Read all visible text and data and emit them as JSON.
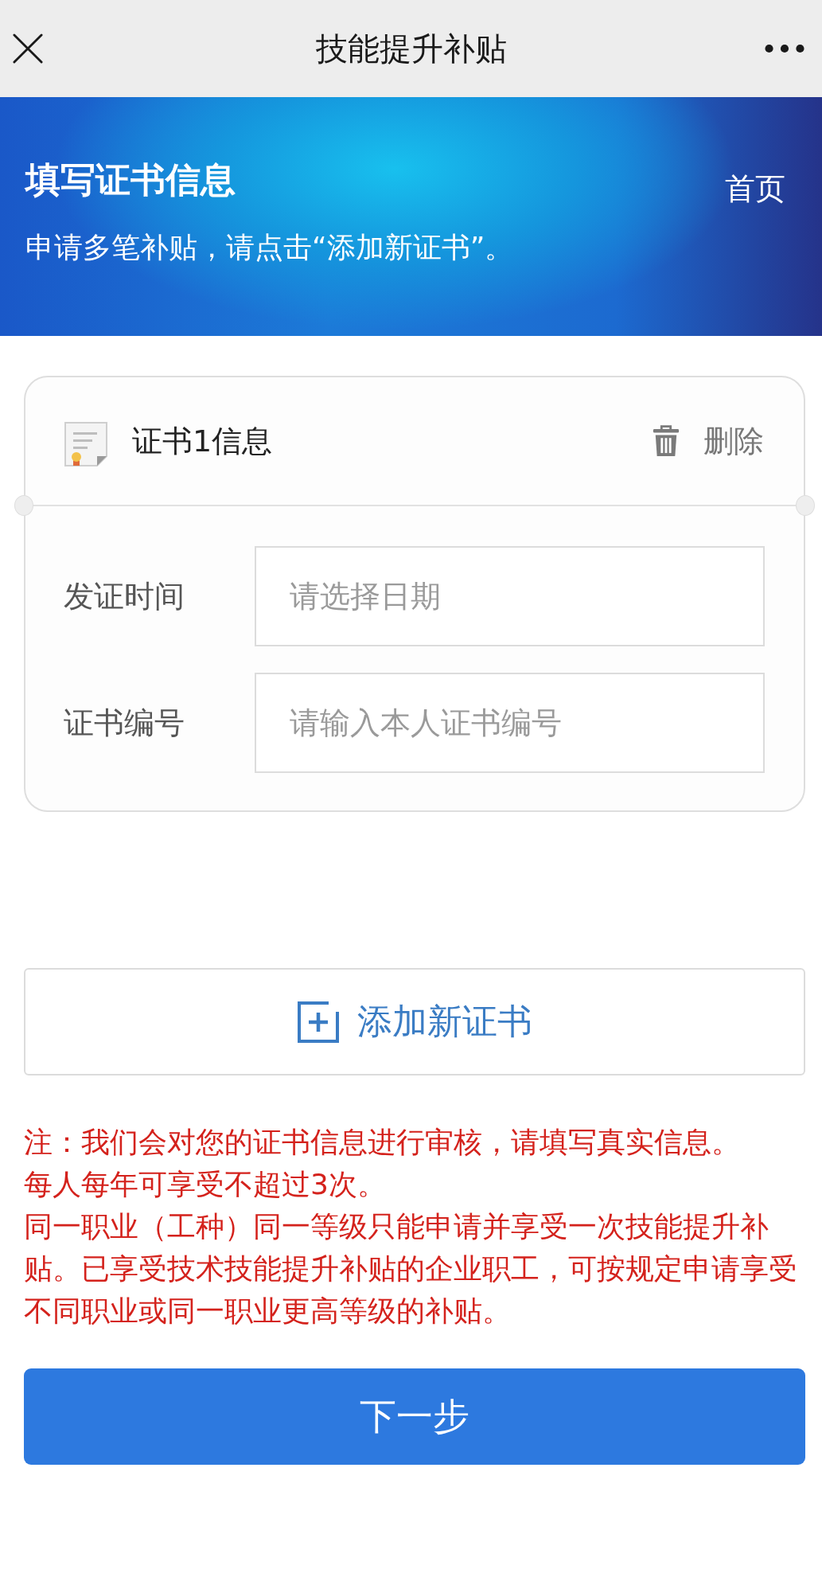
{
  "nav_bar": {
    "title": "技能提升补贴"
  },
  "banner": {
    "title": "填写证书信息",
    "subtitle": "申请多笔补贴，请点击“添加新证书”。",
    "home_link": "首页"
  },
  "certificates": [
    {
      "title": "证书1信息",
      "delete_label": "删除",
      "fields": [
        {
          "label": "发证时间",
          "placeholder": "请选择日期"
        },
        {
          "label": "证书编号",
          "placeholder": "请输入本人证书编号"
        }
      ]
    }
  ],
  "add_button": "添加新证书",
  "notes": [
    "注：我们会对您的证书信息进行审核，请填写真实信息。",
    "每人每年可享受不超过3次。",
    "同一职业（工种）同一等级只能申请并享受一次技能提升补贴。已享受技术技能提升补贴的企业职工，可按规定申请享受不同职业或同一职业更高等级的补贴。"
  ],
  "next_button": "下一步"
}
